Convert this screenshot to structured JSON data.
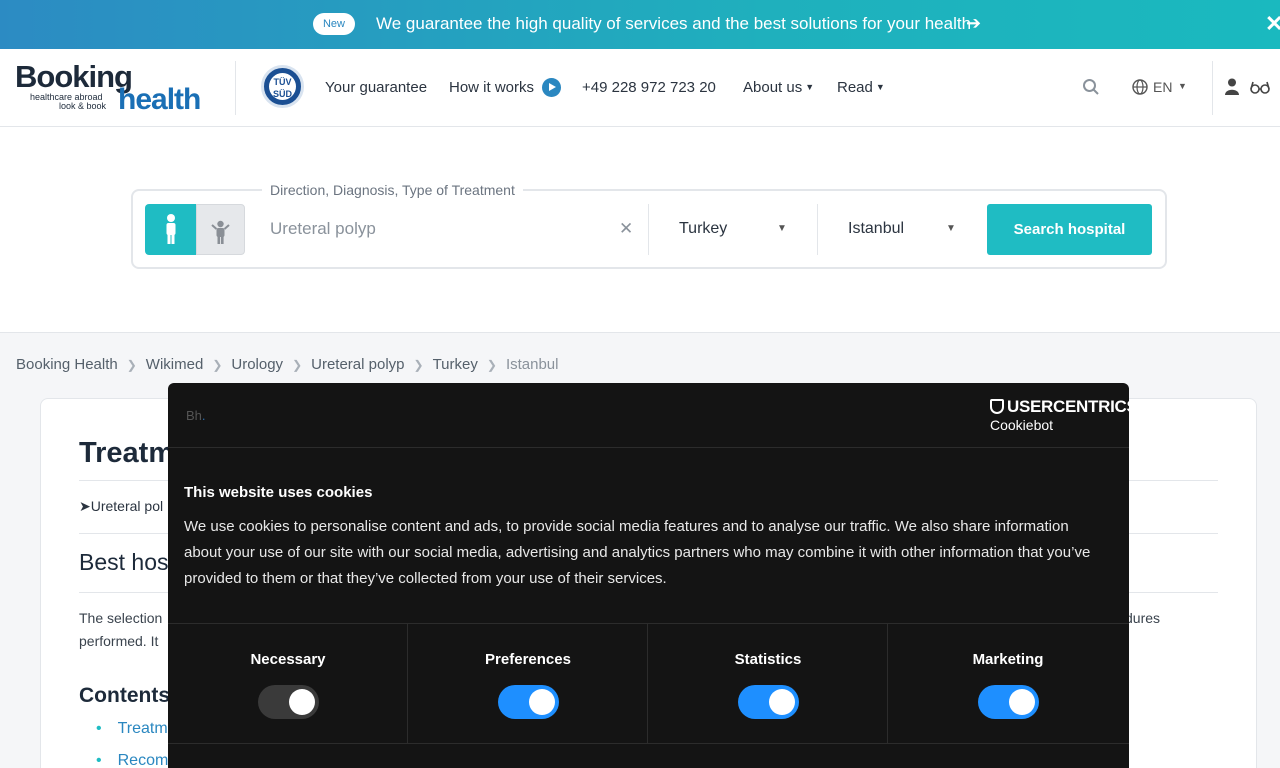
{
  "banner": {
    "badge": "New",
    "text": "We guarantee the high quality of services and the best solutions for your health",
    "arrow_icon": "arrow-right-icon",
    "close_icon": "close-icon"
  },
  "header": {
    "logo": {
      "word1": "Booking",
      "tagline1": "healthcare abroad",
      "tagline2": "look & book",
      "word2": "health"
    },
    "tuv_badge": "TÜV SÜD",
    "nav": {
      "guarantee": "Your guarantee",
      "how_it_works": "How it works",
      "phone": "+49 228 972 723 20",
      "about": "About us",
      "read": "Read"
    },
    "language": "EN"
  },
  "search": {
    "legend": "Direction, Diagnosis, Type of Treatment",
    "query_value": "Ureteral polyp",
    "country": "Turkey",
    "city": "Istanbul",
    "button": "Search hospital"
  },
  "breadcrumb": [
    "Booking Health",
    "Wikimed",
    "Urology",
    "Ureteral polyp",
    "Turkey",
    "Istanbul"
  ],
  "article": {
    "title": "Treatm",
    "sub_link": "➤Ureteral pol",
    "best_heading": "Best hos",
    "para_line1": "The selection",
    "para_line2": "performed. It",
    "para_right": "dures",
    "contents_heading": "Contents",
    "toc": [
      "Treatm",
      "Recom"
    ]
  },
  "cookie_dialog": {
    "site_logo": "Bh",
    "brand": "USERCENTRICS",
    "brand_sub": "Cookiebot",
    "title": "This website uses cookies",
    "body": "We use cookies to personalise content and ads, to provide social media features and to analyse our traffic. We also share information about your use of our site with our social media, advertising and analytics partners who may combine it with other information that you’ve provided to them or that they’ve collected from your use of their services.",
    "categories": [
      {
        "label": "Necessary",
        "enabled": true,
        "locked": true
      },
      {
        "label": "Preferences",
        "enabled": true
      },
      {
        "label": "Statistics",
        "enabled": true
      },
      {
        "label": "Marketing",
        "enabled": true
      }
    ]
  },
  "colors": {
    "accent_teal": "#1fbcc3",
    "brand_blue": "#1a6fb5",
    "toggle_on": "#1e8fff",
    "dialog_bg": "#141414"
  }
}
